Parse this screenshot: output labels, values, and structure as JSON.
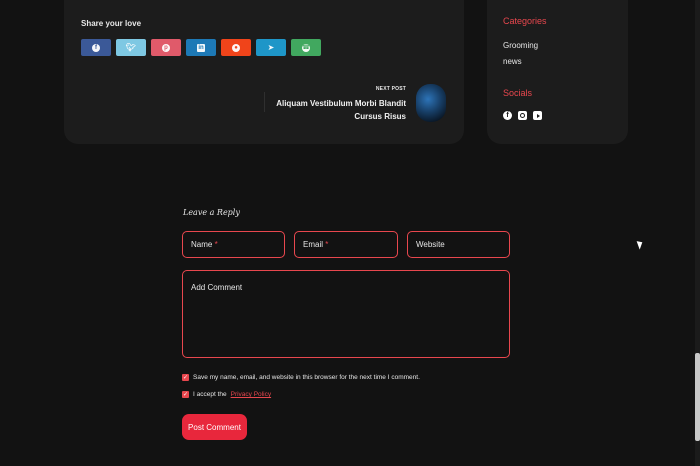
{
  "share": {
    "title": "Share your love",
    "buttons": [
      {
        "name": "facebook",
        "color": "#3b5998",
        "icon": "facebook-icon"
      },
      {
        "name": "twitter",
        "color": "#7ec8e3",
        "icon": "twitter-icon"
      },
      {
        "name": "pinterest",
        "color": "#e05a6a",
        "icon": "pinterest-icon"
      },
      {
        "name": "linkedin",
        "color": "#1d79b6",
        "icon": "linkedin-icon"
      },
      {
        "name": "reddit",
        "color": "#f0441a",
        "icon": "reddit-icon"
      },
      {
        "name": "telegram",
        "color": "#1e96c8",
        "icon": "telegram-icon"
      },
      {
        "name": "whatsapp",
        "color": "#41a85f",
        "icon": "whatsapp-icon"
      }
    ]
  },
  "next_post": {
    "label": "NEXT POST",
    "title": "Aliquam Vestibulum Morbi Blandit Cursus Risus"
  },
  "sidebar": {
    "categories_heading": "Categories",
    "categories": [
      "Grooming",
      "news"
    ],
    "socials_heading": "Socials",
    "socials": [
      "facebook-icon",
      "instagram-icon",
      "youtube-icon"
    ]
  },
  "comment_form": {
    "heading": "Leave a Reply",
    "name_label": "Name",
    "email_label": "Email",
    "required_mark": "*",
    "website_label": "Website",
    "comment_label": "Add Comment",
    "save_info_text": "Save my name, email, and website in this browser for the next time I comment.",
    "accept_text": "I accept the",
    "privacy_link": "Privacy Policy",
    "submit_label": "Post Comment"
  },
  "colors": {
    "accent": "#e8474e",
    "button": "#e8273c",
    "background": "#121212",
    "card": "#1c1c1c"
  }
}
